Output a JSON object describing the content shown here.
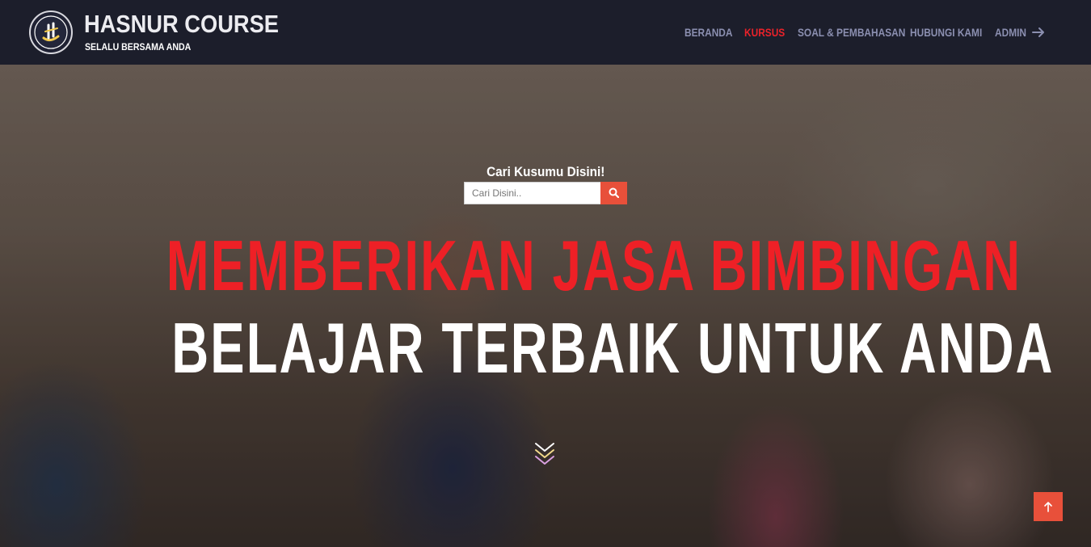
{
  "brand": {
    "title": "HASNUR COURSE",
    "tagline": "SELALU BERSAMA ANDA",
    "logo_icon": "hasnur-logo-icon"
  },
  "nav": {
    "items": [
      {
        "label": "BERANDA",
        "active": false
      },
      {
        "label": "KURSUS",
        "active": true
      },
      {
        "label": "SOAL & PEMBAHASAN",
        "active": false
      },
      {
        "label": "HUBUNGI KAMI",
        "active": false
      },
      {
        "label": "ADMIN",
        "active": false
      }
    ],
    "admin_icon": "arrow-right-icon"
  },
  "search": {
    "label": "Cari Kusumu Disini!",
    "placeholder": "Cari Disini..",
    "value": "",
    "button_icon": "search-icon"
  },
  "hero": {
    "headline_red": "MEMBERIKAN JASA BIMBINGAN",
    "headline_white": "BELAJAR TERBAIK UNTUK ANDA",
    "scroll_icon": "chevrons-down-icon"
  },
  "scroll_top": {
    "icon": "arrow-up-icon"
  },
  "colors": {
    "navbar_bg": "#1c1e2b",
    "nav_text": "#8b8fb0",
    "nav_active": "#e8222a",
    "headline_red": "#ee2026",
    "accent_button": "#e8503a"
  }
}
